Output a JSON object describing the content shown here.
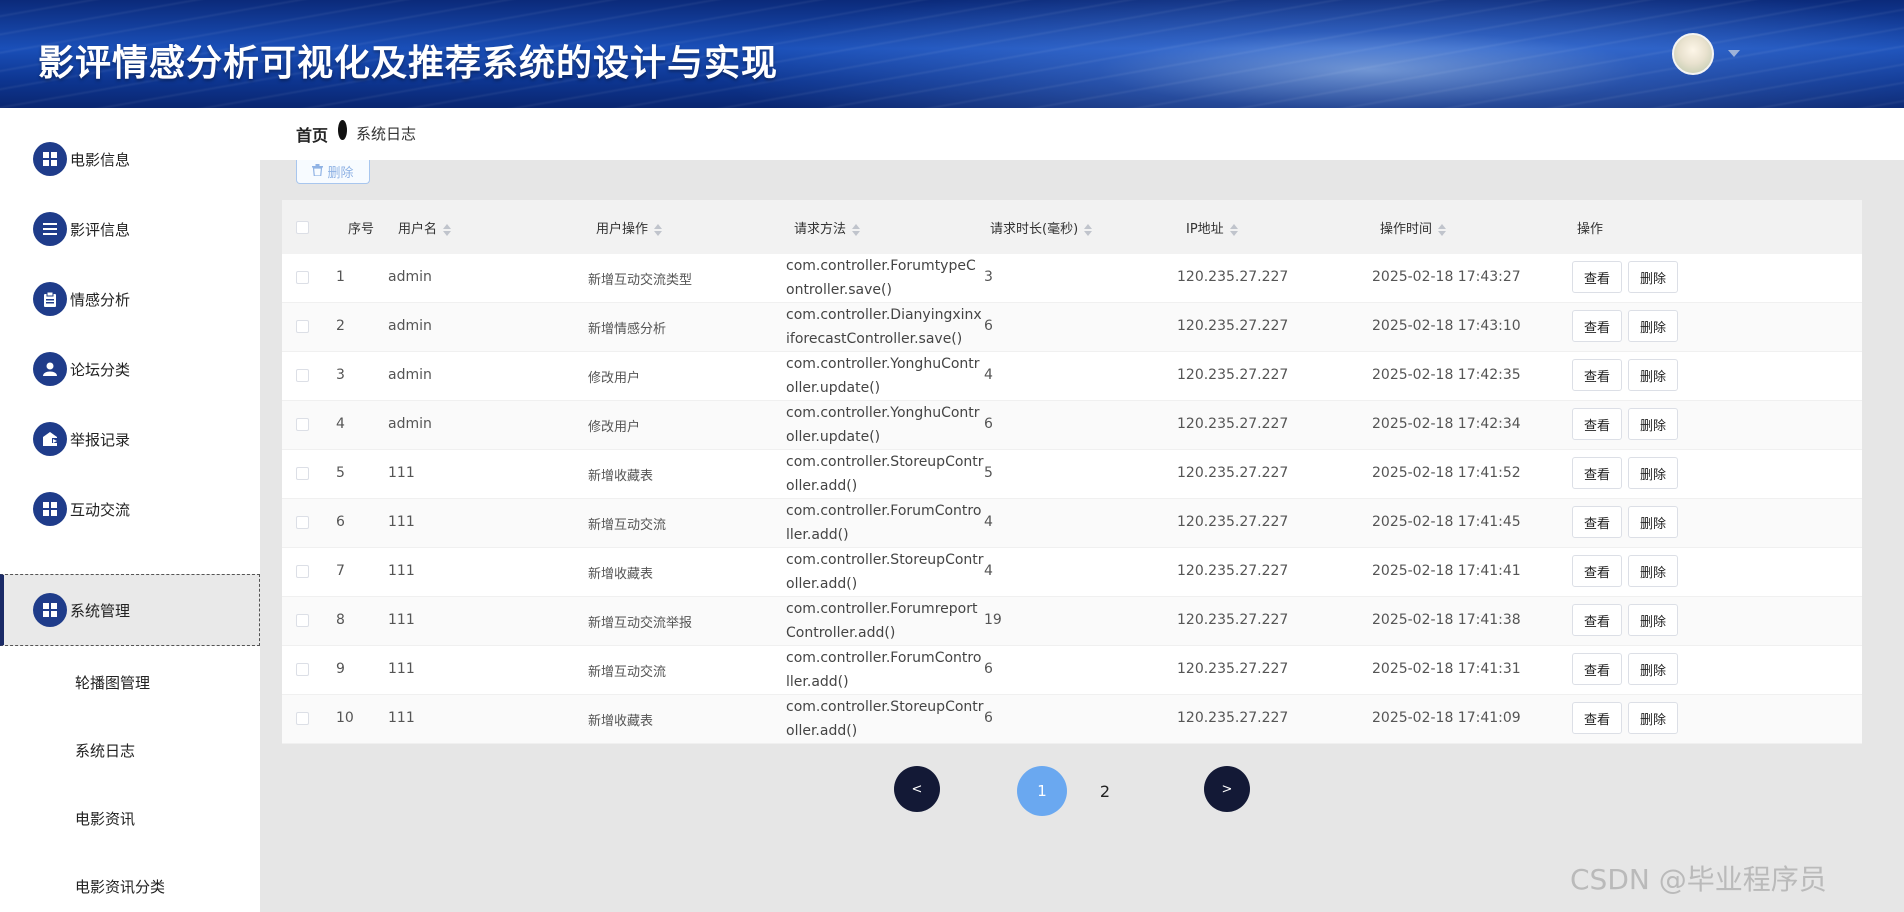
{
  "header": {
    "title": "影评情感分析可视化及推荐系统的设计与实现",
    "avatar_icon": "user-avatar"
  },
  "sidebar": {
    "items": [
      {
        "label": "电影信息",
        "icon": "grid-icon"
      },
      {
        "label": "影评信息",
        "icon": "list-icon"
      },
      {
        "label": "情感分析",
        "icon": "clipboard-icon"
      },
      {
        "label": "论坛分类",
        "icon": "user-icon"
      },
      {
        "label": "举报记录",
        "icon": "report-icon"
      },
      {
        "label": "互动交流",
        "icon": "grid-icon"
      },
      {
        "label": "系统管理",
        "icon": "grid-icon"
      }
    ],
    "subitems": [
      "轮播图管理",
      "系统日志",
      "电影资讯",
      "电影资讯分类"
    ]
  },
  "breadcrumb": {
    "home": "首页",
    "current": "系统日志"
  },
  "toolbar": {
    "delete_label": "删除"
  },
  "table": {
    "headers": [
      "序号",
      "用户名",
      "用户操作",
      "请求方法",
      "请求时长(毫秒)",
      "IP地址",
      "操作时间",
      "操作"
    ],
    "view_label": "查看",
    "delete_label": "删除",
    "rows": [
      {
        "no": "1",
        "user": "admin",
        "op": "新增互动交流类型",
        "method": "com.controller.ForumtypeController.save()",
        "duration": "3",
        "ip": "120.235.27.227",
        "time": "2025-02-18 17:43:27"
      },
      {
        "no": "2",
        "user": "admin",
        "op": "新增情感分析",
        "method": "com.controller.DianyingxinxiforecastController.save()",
        "duration": "6",
        "ip": "120.235.27.227",
        "time": "2025-02-18 17:43:10"
      },
      {
        "no": "3",
        "user": "admin",
        "op": "修改用户",
        "method": "com.controller.YonghuController.update()",
        "duration": "4",
        "ip": "120.235.27.227",
        "time": "2025-02-18 17:42:35"
      },
      {
        "no": "4",
        "user": "admin",
        "op": "修改用户",
        "method": "com.controller.YonghuController.update()",
        "duration": "6",
        "ip": "120.235.27.227",
        "time": "2025-02-18 17:42:34"
      },
      {
        "no": "5",
        "user": "111",
        "op": "新增收藏表",
        "method": "com.controller.StoreupController.add()",
        "duration": "5",
        "ip": "120.235.27.227",
        "time": "2025-02-18 17:41:52"
      },
      {
        "no": "6",
        "user": "111",
        "op": "新增互动交流",
        "method": "com.controller.ForumController.add()",
        "duration": "4",
        "ip": "120.235.27.227",
        "time": "2025-02-18 17:41:45"
      },
      {
        "no": "7",
        "user": "111",
        "op": "新增收藏表",
        "method": "com.controller.StoreupController.add()",
        "duration": "4",
        "ip": "120.235.27.227",
        "time": "2025-02-18 17:41:41"
      },
      {
        "no": "8",
        "user": "111",
        "op": "新增互动交流举报",
        "method": "com.controller.ForumreportController.add()",
        "duration": "19",
        "ip": "120.235.27.227",
        "time": "2025-02-18 17:41:38"
      },
      {
        "no": "9",
        "user": "111",
        "op": "新增互动交流",
        "method": "com.controller.ForumController.add()",
        "duration": "6",
        "ip": "120.235.27.227",
        "time": "2025-02-18 17:41:31"
      },
      {
        "no": "10",
        "user": "111",
        "op": "新增收藏表",
        "method": "com.controller.StoreupController.add()",
        "duration": "6",
        "ip": "120.235.27.227",
        "time": "2025-02-18 17:41:09"
      }
    ]
  },
  "pagination": {
    "prev": "<",
    "next": ">",
    "pages": [
      "1",
      "2"
    ],
    "current": "1"
  },
  "watermark": "CSDN @毕业程序员",
  "colors": {
    "header": "#1a4fb8",
    "menu_icon": "#1f3c8a",
    "page_active": "#6aa8f0",
    "page_nav": "#131936"
  }
}
